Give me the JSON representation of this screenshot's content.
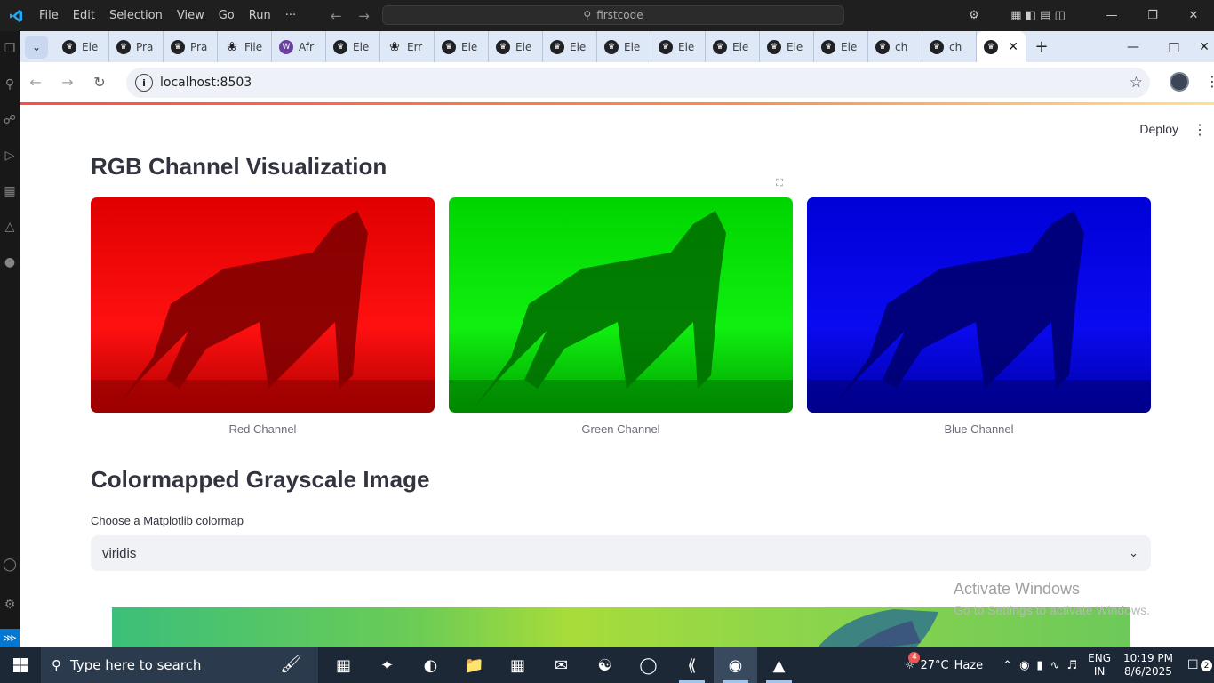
{
  "vscode": {
    "menu": [
      "File",
      "Edit",
      "Selection",
      "View",
      "Go",
      "Run",
      "···"
    ],
    "search": "firstcode"
  },
  "browser": {
    "tabs": [
      {
        "label": "Ele",
        "icon": "crown"
      },
      {
        "label": "Pra",
        "icon": "crown"
      },
      {
        "label": "Pra",
        "icon": "crown"
      },
      {
        "label": "File",
        "icon": "chatgpt"
      },
      {
        "label": "Afr",
        "icon": "wiki"
      },
      {
        "label": "Ele",
        "icon": "crown"
      },
      {
        "label": "Err",
        "icon": "chatgpt"
      },
      {
        "label": "Ele",
        "icon": "crown"
      },
      {
        "label": "Ele",
        "icon": "crown"
      },
      {
        "label": "Ele",
        "icon": "crown"
      },
      {
        "label": "Ele",
        "icon": "crown"
      },
      {
        "label": "Ele",
        "icon": "crown"
      },
      {
        "label": "Ele",
        "icon": "crown"
      },
      {
        "label": "Ele",
        "icon": "crown"
      },
      {
        "label": "Ele",
        "icon": "crown"
      },
      {
        "label": "ch",
        "icon": "crown"
      },
      {
        "label": "ch",
        "icon": "crown"
      }
    ],
    "url": "localhost:8503"
  },
  "app": {
    "deploy": "Deploy",
    "title": "RGB Channel Visualization",
    "captions": [
      "Red Channel",
      "Green Channel",
      "Blue Channel"
    ],
    "section2": "Colormapped Grayscale Image",
    "select_label": "Choose a Matplotlib colormap",
    "select_value": "viridis"
  },
  "watermark": {
    "line1": "Activate Windows",
    "line2": "Go to Settings to activate Windows."
  },
  "taskbar": {
    "search_placeholder": "Type here to search",
    "weather_temp": "27°C",
    "weather_desc": "Haze",
    "weather_badge": "4",
    "lang1": "ENG",
    "lang2": "IN",
    "time": "10:19 PM",
    "date": "8/6/2025",
    "notif_count": "2"
  },
  "colors": {
    "red_channel": "#ff0000",
    "green_channel": "#00ff00",
    "blue_channel": "#0000ff",
    "accent": "#ff4b4b"
  }
}
